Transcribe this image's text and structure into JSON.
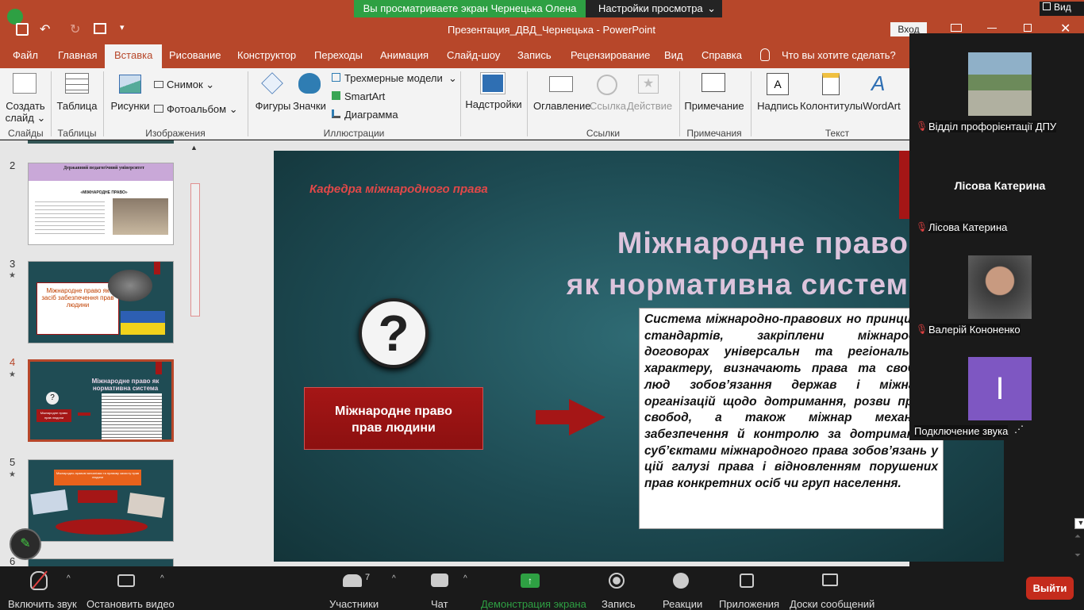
{
  "zoom_banner": {
    "viewing": "Вы просматриваете экран Чернецька Олена",
    "view_settings": "Настройки просмотра"
  },
  "window": {
    "title": "Презентация_ДВД_Чернецька  -  PowerPoint",
    "signin": "Вход",
    "view_label": "Вид"
  },
  "tabs": [
    "Файл",
    "Главная",
    "Вставка",
    "Рисование",
    "Конструктор",
    "Переходы",
    "Анимация",
    "Слайд-шоу",
    "Запись",
    "Рецензирование",
    "Вид",
    "Справка"
  ],
  "tell_me": "Что вы хотите сделать?",
  "ribbon": {
    "new_slide": "Создать слайд",
    "table": "Таблица",
    "pictures": "Рисунки",
    "screenshot": "Снимок",
    "photo_album": "Фотоальбом",
    "shapes": "Фигуры",
    "icons": "Значки",
    "models3d": "Трехмерные модели",
    "smartart": "SmartArt",
    "chart": "Диаграмма",
    "addins": "Надстройки",
    "toc": "Оглавление",
    "link": "Ссылка",
    "action": "Действие",
    "comment": "Примечание",
    "textbox": "Надпись",
    "header_footer": "Колонтитулы",
    "wordart": "WordArt",
    "groups": {
      "slides": "Слайды",
      "tables": "Таблицы",
      "images": "Изображения",
      "illustrations": "Иллюстрации",
      "links": "Ссылки",
      "comments": "Примечания",
      "text": "Текст"
    }
  },
  "thumbnails": [
    {
      "num": "2",
      "title": "Державний педагогічний університет",
      "sub": "«МІЖНАРОДНЕ ПРАВО»"
    },
    {
      "num": "3",
      "title": "Міжнародне право як засіб забезпечення прав людини"
    },
    {
      "num": "4",
      "title": "Міжнародне право як нормативна система",
      "box": "Міжнародне право прав людини"
    },
    {
      "num": "5",
      "title": "Міжнародно-правові механізми та правову захисту прав людини"
    },
    {
      "num": "6"
    }
  ],
  "slide": {
    "dept": "Кафедра міжнародного права",
    "title1": "Міжнародне право",
    "title2": "як нормативна систем",
    "box_label": "Міжнародне право прав людини",
    "body": "Система міжнародно-правових но принципів і стандартів, закріплени міжнародних договорах універсальн та регіонального характеру, визначають права та свободи люд зобов’язання держав і міжнарод організацій щодо дотримання, розви прав і свобод, а також міжнар механізми забезпечення й контролю за дотриманням суб’єктами міжнародного права зобов’язань у цій галузі права і відновленням порушених прав конкретних осіб чи груп населення."
  },
  "participants": [
    {
      "name": "Відділ профорієнтації ДПУ",
      "muted": true
    },
    {
      "name": "Лісова Катерина",
      "display": "Лісова Катерина",
      "muted": true
    },
    {
      "name": "Валерій Кононенко",
      "muted": true
    },
    {
      "name": "Подключение звука",
      "initial": "І"
    }
  ],
  "controls": {
    "mute": "Включить звук",
    "video": "Остановить видео",
    "participants": "Участники",
    "participants_count": "7",
    "chat": "Чат",
    "share": "Демонстрация экрана",
    "record": "Запись",
    "reactions": "Реакции",
    "apps": "Приложения",
    "whiteboards": "Доски сообщений",
    "leave": "Выйти"
  },
  "colors": {
    "ppt_accent": "#b7472a",
    "zoom_green": "#2ea043",
    "leave_red": "#c42b1c",
    "slide_red": "#a51616"
  }
}
